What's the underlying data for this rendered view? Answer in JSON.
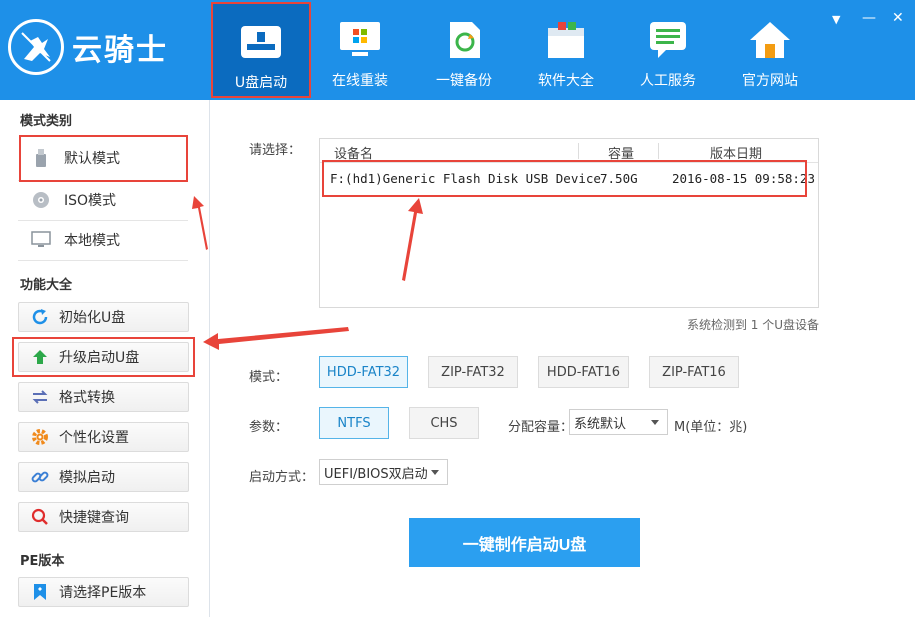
{
  "app": {
    "title": "云骑士"
  },
  "nav": {
    "tabs": [
      {
        "label": "U盘启动",
        "icon": "usb-drive-icon",
        "active": true
      },
      {
        "label": "在线重装",
        "icon": "monitor-windows-icon",
        "active": false
      },
      {
        "label": "一键备份",
        "icon": "backup-file-icon",
        "active": false
      },
      {
        "label": "软件大全",
        "icon": "software-box-icon",
        "active": false
      },
      {
        "label": "人工服务",
        "icon": "chat-service-icon",
        "active": false
      },
      {
        "label": "官方网站",
        "icon": "home-icon",
        "active": false
      }
    ],
    "window_controls": {
      "menu": "▼",
      "minimize": "—",
      "close": "✕"
    }
  },
  "sidebar": {
    "mode_title": "模式类别",
    "modes": [
      {
        "label": "默认模式",
        "icon": "usb-stick-icon",
        "selected": true
      },
      {
        "label": "ISO模式",
        "icon": "disc-icon",
        "selected": false
      },
      {
        "label": "本地模式",
        "icon": "monitor-icon",
        "selected": false
      }
    ],
    "func_title": "功能大全",
    "functions": [
      {
        "label": "初始化U盘",
        "icon": "refresh-icon"
      },
      {
        "label": "升级启动U盘",
        "icon": "arrow-up-icon"
      },
      {
        "label": "格式转换",
        "icon": "swap-icon"
      },
      {
        "label": "个性化设置",
        "icon": "gear-icon"
      },
      {
        "label": "模拟启动",
        "icon": "link-icon"
      },
      {
        "label": "快捷键查询",
        "icon": "search-icon"
      }
    ],
    "pe_title": "PE版本",
    "pe_button": {
      "label": "请选择PE版本",
      "icon": "bookmark-icon"
    }
  },
  "main": {
    "select_label": "请选择：",
    "table": {
      "headers": [
        "设备名",
        "容量",
        "版本日期"
      ],
      "rows": [
        {
          "name": "F:(hd1)Generic Flash Disk USB Device",
          "capacity": "7.50G",
          "date": "2016-08-15 09:58:23"
        }
      ]
    },
    "detect_text": "系统检测到 1 个U盘设备",
    "mode_label": "模式：",
    "mode_options": [
      "HDD-FAT32",
      "ZIP-FAT32",
      "HDD-FAT16",
      "ZIP-FAT16"
    ],
    "mode_selected": "HDD-FAT32",
    "param_label": "参数：",
    "param_options": [
      "NTFS",
      "CHS"
    ],
    "param_selected": "NTFS",
    "alloc_label": "分配容量：",
    "alloc_value": "系统默认",
    "alloc_unit": "M(单位：兆)",
    "boot_label": "启动方式：",
    "boot_value": "UEFI/BIOS双启动",
    "make_button": "一键制作启动U盘"
  },
  "colors": {
    "header": "#1e90e8",
    "active_tab": "#0b6bbf",
    "accent": "#2b9ff0",
    "highlight": "#e8443a"
  }
}
